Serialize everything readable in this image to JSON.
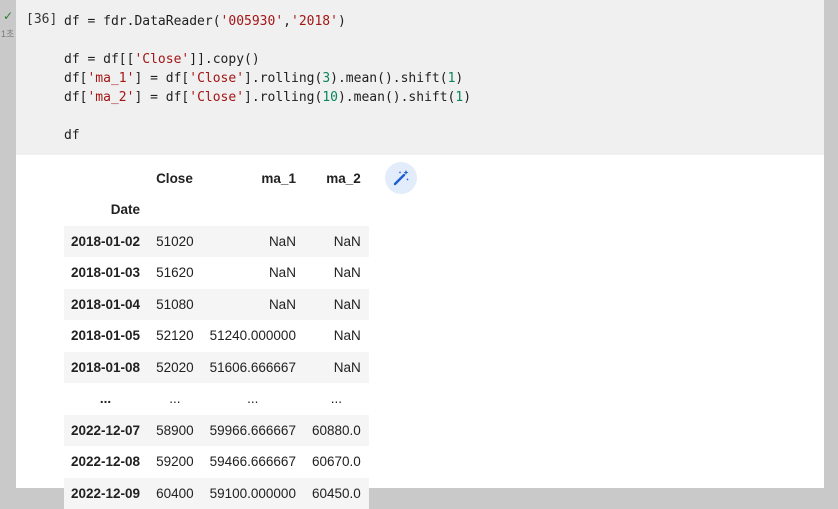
{
  "gutter": {
    "check_symbol": "✓",
    "exec_time": "1초"
  },
  "cell": {
    "execution_count": "[36]",
    "code_lines": [
      "df = fdr.DataReader('005930','2018')",
      "",
      "df = df[['Close']].copy()",
      "df['ma_1'] = df['Close'].rolling(3).mean().shift(1)",
      "df['ma_2'] = df['Close'].rolling(10).mean().shift(1)",
      "",
      "df"
    ]
  },
  "output": {
    "columns": [
      "Close",
      "ma_1",
      "ma_2"
    ],
    "index_name": "Date",
    "rows": [
      {
        "date": "2018-01-02",
        "close": "51020",
        "ma_1": "NaN",
        "ma_2": "NaN"
      },
      {
        "date": "2018-01-03",
        "close": "51620",
        "ma_1": "NaN",
        "ma_2": "NaN"
      },
      {
        "date": "2018-01-04",
        "close": "51080",
        "ma_1": "NaN",
        "ma_2": "NaN"
      },
      {
        "date": "2018-01-05",
        "close": "52120",
        "ma_1": "51240.000000",
        "ma_2": "NaN"
      },
      {
        "date": "2018-01-08",
        "close": "52020",
        "ma_1": "51606.666667",
        "ma_2": "NaN"
      },
      {
        "date": "...",
        "close": "...",
        "ma_1": "...",
        "ma_2": "..."
      },
      {
        "date": "2022-12-07",
        "close": "58900",
        "ma_1": "59966.666667",
        "ma_2": "60880.0"
      },
      {
        "date": "2022-12-08",
        "close": "59200",
        "ma_1": "59466.666667",
        "ma_2": "60670.0"
      },
      {
        "date": "2022-12-09",
        "close": "60400",
        "ma_1": "59100.000000",
        "ma_2": "60450.0"
      }
    ],
    "magic_icon": "magic-wand-icon"
  }
}
